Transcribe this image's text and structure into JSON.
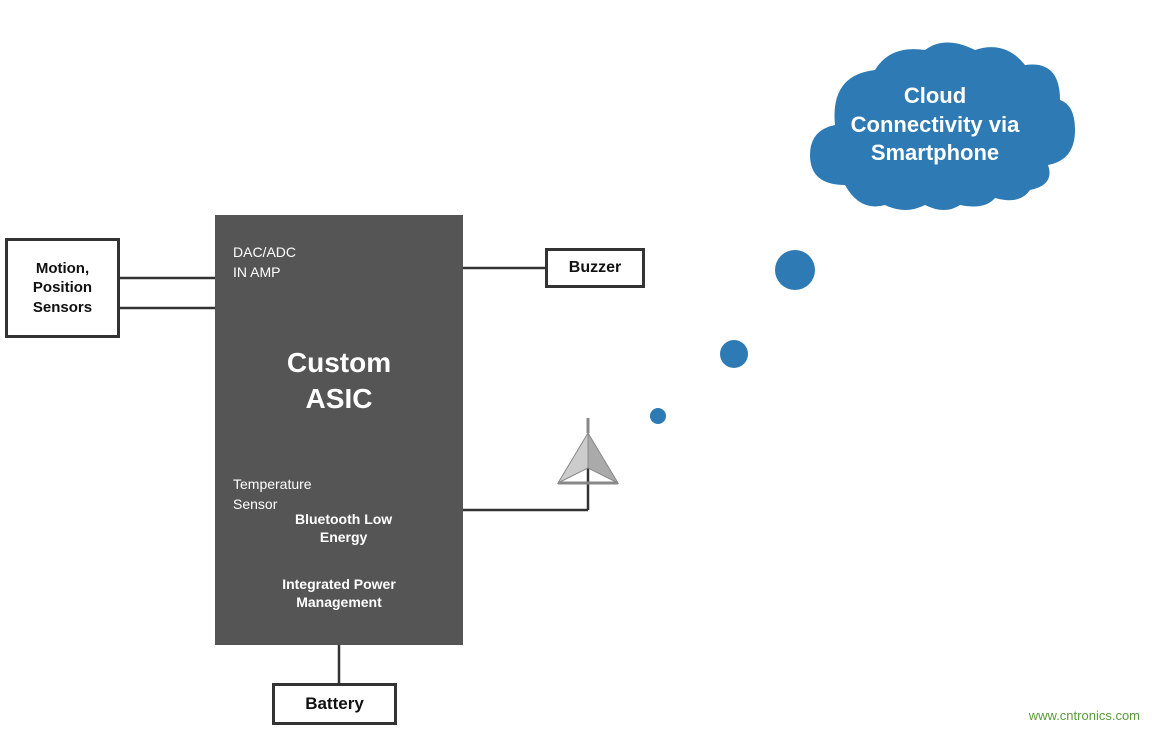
{
  "cloud": {
    "text": "Cloud\nConnectivity via\nSmartphone",
    "line1": "Cloud",
    "line2": "Connectivity via",
    "line3": "Smartphone",
    "fill": "#2d7ab5"
  },
  "asic": {
    "dac_label": "DAC/ADC\nIN AMP",
    "main_label": "Custom\nASIC",
    "temp_label": "Temperature\nSensor",
    "ble_label": "Bluetooth Low\nEnergy",
    "power_label": "Integrated Power\nManagement",
    "bg_color": "#555555"
  },
  "sensors": {
    "label": "Motion,\nPosition\nSensors"
  },
  "buzzer": {
    "label": "Buzzer"
  },
  "battery": {
    "label": "Battery"
  },
  "watermark": {
    "text": "www.cntronics.com"
  }
}
